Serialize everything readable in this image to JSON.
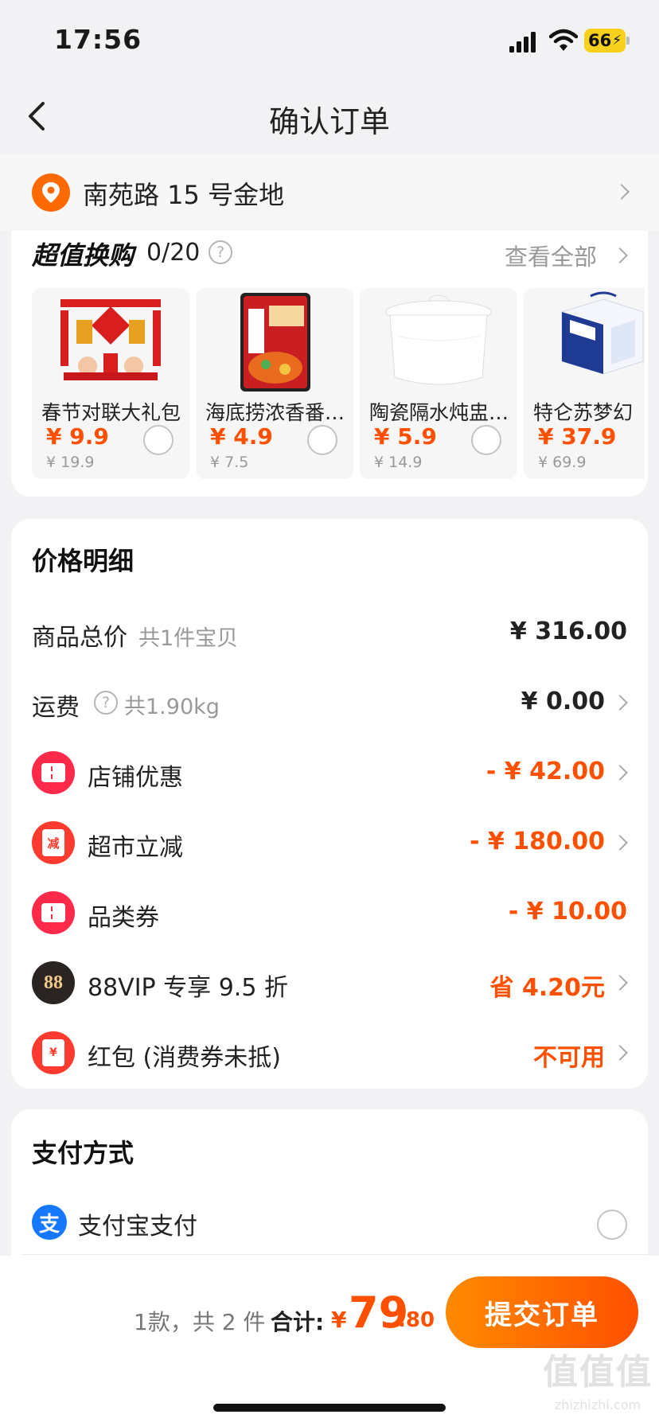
{
  "status_bar": {
    "time": "17:56",
    "battery": "66"
  },
  "nav": {
    "title": "确认订单"
  },
  "address": {
    "text": "南苑路 15 号金地"
  },
  "swap": {
    "title": "超值换购",
    "count": "0/20",
    "view_all": "查看全部",
    "products": [
      {
        "name": "春节对联大礼包",
        "price": "¥ 9.9",
        "original_price": "¥ 19.9"
      },
      {
        "name": "海底捞浓香番…",
        "price": "¥ 4.9",
        "original_price": "¥ 7.5"
      },
      {
        "name": "陶瓷隔水炖盅…",
        "price": "¥ 5.9",
        "original_price": "¥ 14.9"
      },
      {
        "name": "特仑苏梦幻",
        "price": "¥ 37.9",
        "original_price": "¥ 69.9"
      }
    ]
  },
  "price_detail": {
    "title": "价格明细",
    "goods_total": {
      "label": "商品总价",
      "sub": "共1件宝贝",
      "value": "¥ 316.00"
    },
    "shipping": {
      "label": "运费",
      "sub": "共1.90kg",
      "value": "¥ 0.00"
    },
    "shop_discount": {
      "label": "店铺优惠",
      "value": "- ¥ 42.00"
    },
    "market_reduce": {
      "label": "超市立减",
      "value": "- ¥ 180.00",
      "icon_text": "减"
    },
    "category_coupon": {
      "label": "品类券",
      "value": "- ¥ 10.00"
    },
    "vip": {
      "label": "88VIP 专享 9.5 折",
      "value": "省 4.20元",
      "icon_text": "88"
    },
    "red_packet": {
      "label": "红包 (消费券未抵)",
      "value": "不可用",
      "icon_text": "¥"
    }
  },
  "payment": {
    "title": "支付方式",
    "alipay_label": "支付宝支付",
    "alipay_icon_text": "支"
  },
  "bottom": {
    "count": "1款，共 2 件",
    "total_label": "合计:",
    "yen": "¥",
    "total_int": "79",
    "total_dec": ".80",
    "submit": "提交订单"
  },
  "watermark": {
    "logo": "值值值",
    "url": "zhizhizhi.com"
  },
  "colors": {
    "accent": "#ff5000",
    "button_start": "#ff8a00",
    "alipay": "#1677ff",
    "coupon": "#ff2a4a"
  }
}
